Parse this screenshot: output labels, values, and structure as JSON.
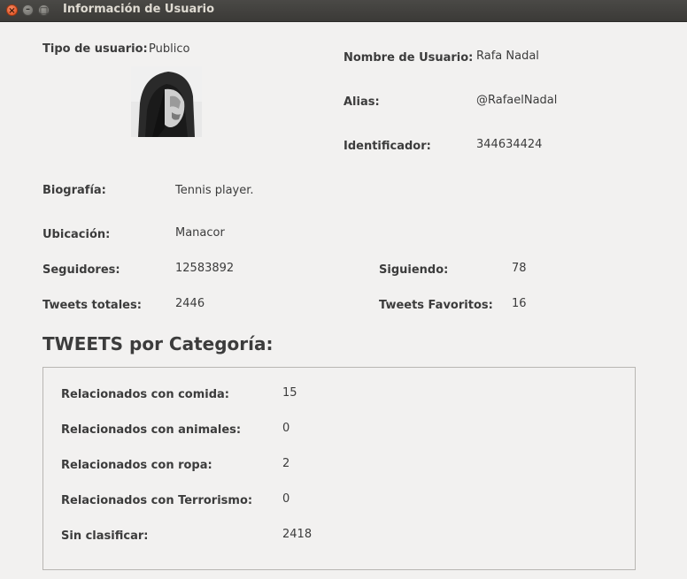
{
  "window": {
    "title": "Información de Usuario",
    "close_glyph": "×",
    "min_glyph": "–",
    "max_glyph": "□"
  },
  "profile": {
    "tipo_label": "Tipo de usuario:",
    "tipo_value": "Publico",
    "nombre_label": "Nombre de Usuario:",
    "nombre_value": "Rafa Nadal",
    "alias_label": "Alias:",
    "alias_value": "@RafaelNadal",
    "id_label": "Identificador:",
    "id_value": "344634424",
    "bio_label": "Biografía:",
    "bio_value": "Tennis player.",
    "ubicacion_label": "Ubicación:",
    "ubicacion_value": "Manacor",
    "seguidores_label": "Seguidores:",
    "seguidores_value": "12583892",
    "siguiendo_label": "Siguiendo:",
    "siguiendo_value": "78",
    "tweets_label": "Tweets totales:",
    "tweets_value": "2446",
    "favoritos_label": "Tweets Favoritos:",
    "favoritos_value": "16"
  },
  "categories": {
    "title": "TWEETS por Categoría:",
    "comida_label": "Relacionados con comida:",
    "comida_value": "15",
    "animales_label": "Relacionados con animales:",
    "animales_value": "0",
    "ropa_label": "Relacionados con ropa:",
    "ropa_value": "2",
    "terrorismo_label": "Relacionados con Terrorismo:",
    "terrorismo_value": "0",
    "sin_label": "Sin clasificar:",
    "sin_value": "2418"
  }
}
